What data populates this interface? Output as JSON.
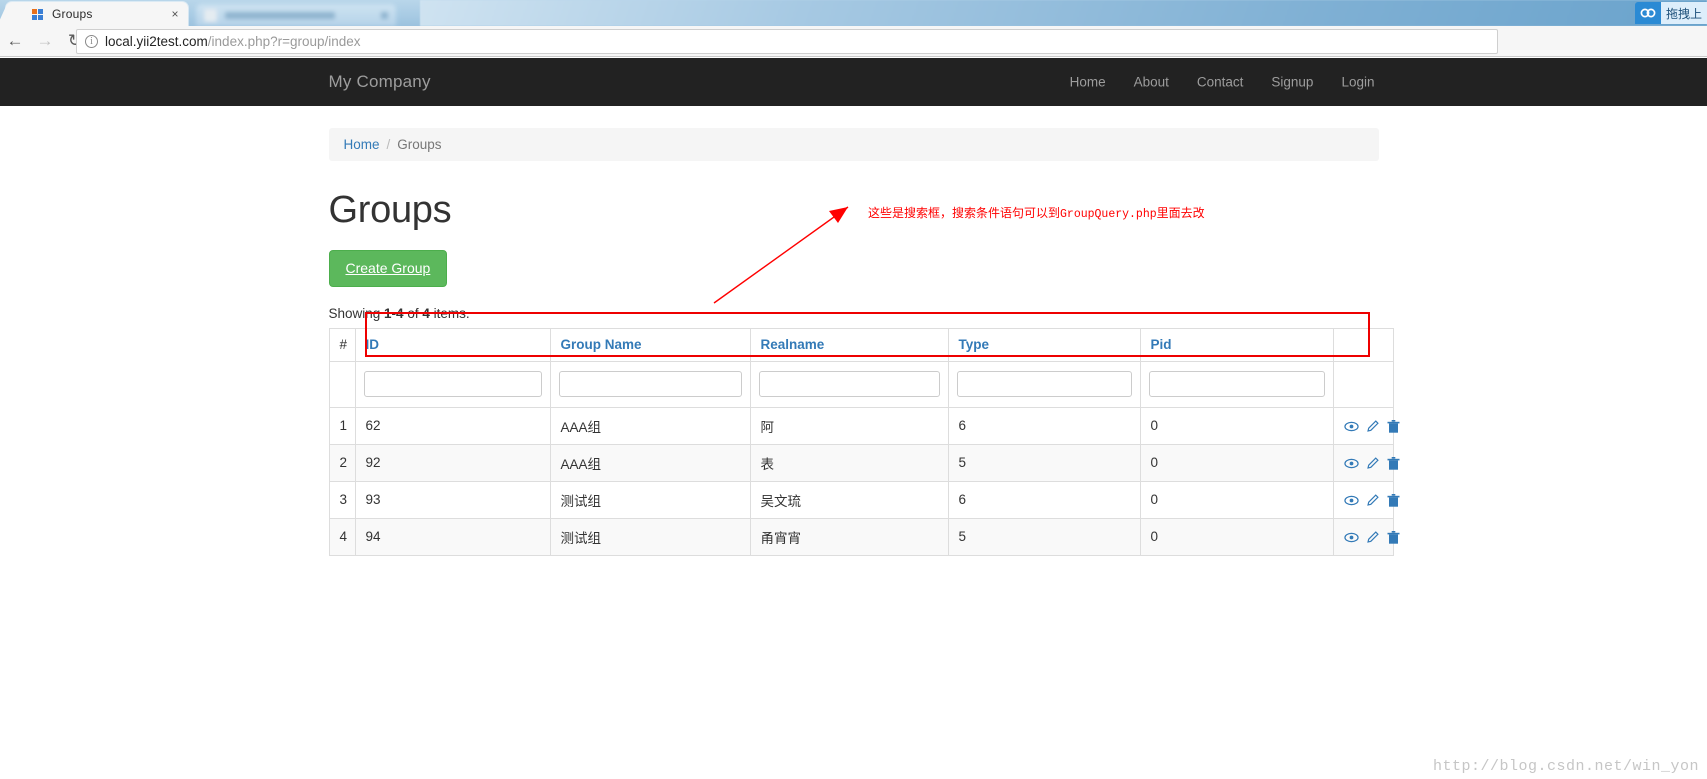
{
  "browser": {
    "tab_title": "Groups",
    "tab_close": "×",
    "back_icon": "←",
    "forward_icon": "→",
    "reload_icon": "↻",
    "url_host": "local.yii2test.com",
    "url_path": "/index.php?r=group/index",
    "info_icon": "i",
    "extension_label": "拖拽上"
  },
  "navbar": {
    "brand": "My Company",
    "links": [
      {
        "label": "Home"
      },
      {
        "label": "About"
      },
      {
        "label": "Contact"
      },
      {
        "label": "Signup"
      },
      {
        "label": "Login"
      }
    ]
  },
  "breadcrumb": {
    "home": "Home",
    "separator": "/",
    "current": "Groups"
  },
  "main": {
    "title": "Groups",
    "create_button": "Create Group",
    "summary_prefix": "Showing ",
    "summary_range": "1-4",
    "summary_middle": " of ",
    "summary_total": "4",
    "summary_suffix": " items."
  },
  "table": {
    "headers": {
      "num": "#",
      "id": "ID",
      "group_name": "Group Name",
      "realname": "Realname",
      "type": "Type",
      "pid": "Pid",
      "actions": ""
    },
    "filters": {
      "id": "",
      "group_name": "",
      "realname": "",
      "type": "",
      "pid": ""
    },
    "rows": [
      {
        "num": "1",
        "id": "62",
        "group_name": "AAA组",
        "realname": "阿",
        "type": "6",
        "pid": "0"
      },
      {
        "num": "2",
        "id": "92",
        "group_name": "AAA组",
        "realname": "表",
        "type": "5",
        "pid": "0"
      },
      {
        "num": "3",
        "id": "93",
        "group_name": "测试组",
        "realname": "吴文琉",
        "type": "6",
        "pid": "0"
      },
      {
        "num": "4",
        "id": "94",
        "group_name": "测试组",
        "realname": "甬宵宵",
        "type": "5",
        "pid": "0"
      }
    ],
    "row_actions": [
      {
        "name": "view",
        "icon": "eye-icon"
      },
      {
        "name": "update",
        "icon": "pencil-icon"
      },
      {
        "name": "delete",
        "icon": "trash-icon"
      }
    ]
  },
  "annotation": {
    "text_part1": "这些是搜索框，搜索条件语句可以到",
    "text_mono": "GroupQuery.php",
    "text_part2": "里面去改"
  },
  "watermark": "http://blog.csdn.net/win_yon",
  "colors": {
    "navbar_bg": "#222222",
    "primary_link": "#337ab7",
    "success_green": "#5cb85c",
    "annotation_red": "#ff0000",
    "highlight_red": "#ee0000"
  }
}
